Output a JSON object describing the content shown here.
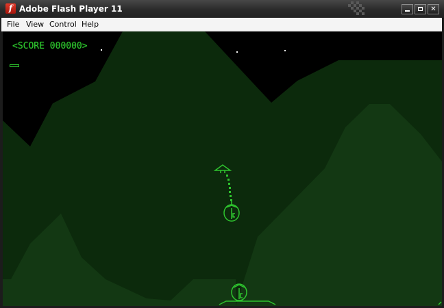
{
  "window": {
    "title": "Adobe Flash Player 11",
    "app_icon_glyph": "f",
    "controls": {
      "minimize": "minimize-icon",
      "maximize": "maximize-icon",
      "close_glyph": "✕"
    }
  },
  "menu": {
    "items": [
      "File",
      "View",
      "Control",
      "Help"
    ]
  },
  "game": {
    "score_text": "<SCORE 000000>",
    "fuel_level": 0.2,
    "colors": {
      "foreground_green": "#2ec42e",
      "terrain_far": "#0c2a0c",
      "terrain_near": "#133813",
      "sky": "#000000"
    },
    "icons": {
      "player_ship": "lander-ship-icon",
      "tractor_beam": "tractor-beam-icon",
      "carried_pod": "fuel-pod-icon",
      "base_pod": "base-pod-icon",
      "landing_pad": "landing-pad-icon",
      "fuel_gauge": "fuel-gauge-icon"
    }
  }
}
